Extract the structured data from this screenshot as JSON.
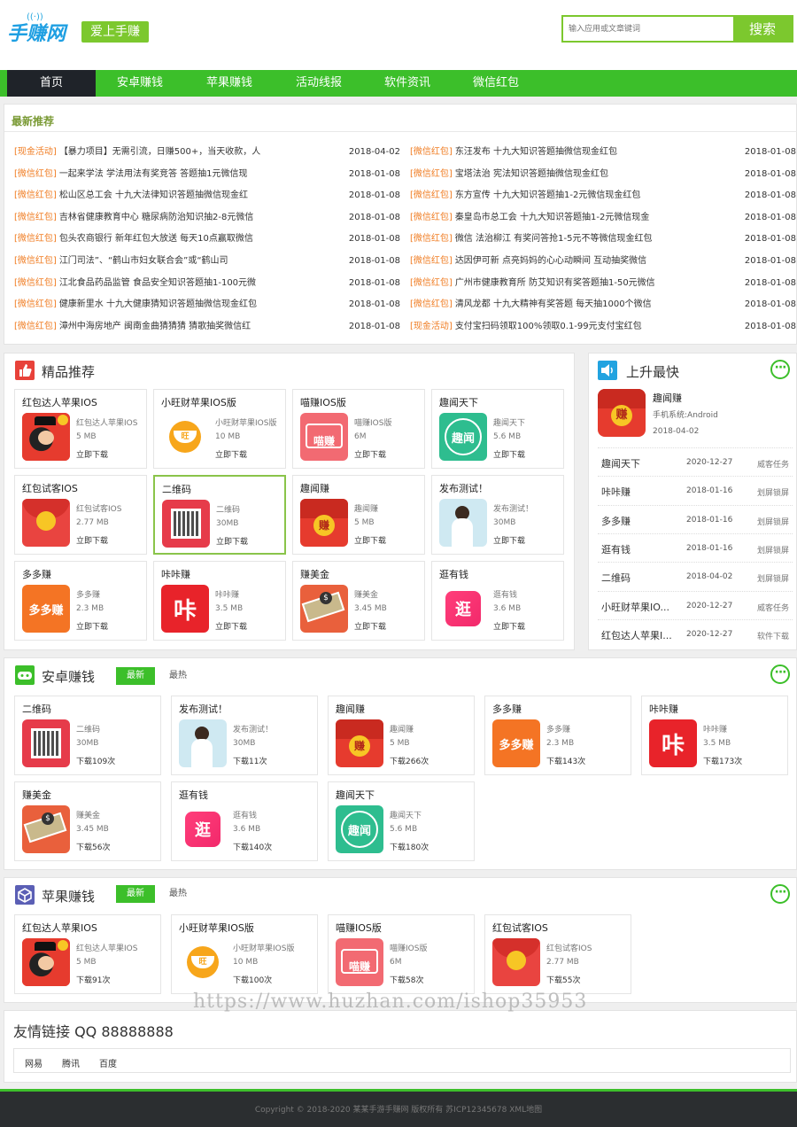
{
  "header": {
    "logo_text": "手赚网",
    "slogan": "爱上手赚",
    "search_placeholder": "输入应用或文章键词",
    "search_button": "搜索"
  },
  "nav": [
    "首页",
    "安卓赚钱",
    "苹果赚钱",
    "活动线报",
    "软件资讯",
    "微信红包"
  ],
  "latest": {
    "title": "最新推荐",
    "left": [
      {
        "cat": "[现金活动]",
        "title": "【暴力项目】无需引流，日赚500+，当天收款，人",
        "date": "2018-04-02"
      },
      {
        "cat": "[微信红包]",
        "title": "一起来学法 学法用法有奖竞答 答题抽1元微信现",
        "date": "2018-01-08"
      },
      {
        "cat": "[微信红包]",
        "title": "松山区总工会 十九大法律知识答题抽微信现金红",
        "date": "2018-01-08"
      },
      {
        "cat": "[微信红包]",
        "title": "吉林省健康教育中心 糖尿病防治知识抽2-8元微信",
        "date": "2018-01-08"
      },
      {
        "cat": "[微信红包]",
        "title": "包头农商银行 新年红包大放送 每天10点赢取微信",
        "date": "2018-01-08"
      },
      {
        "cat": "[微信红包]",
        "title": "江门司法”、“鹤山市妇女联合会”或“鹤山司",
        "date": "2018-01-08"
      },
      {
        "cat": "[微信红包]",
        "title": "江北食品药品监管 食品安全知识答题抽1-100元微",
        "date": "2018-01-08"
      },
      {
        "cat": "[微信红包]",
        "title": "健康新里水 十九大健康猜知识答题抽微信现金红包",
        "date": "2018-01-08"
      },
      {
        "cat": "[微信红包]",
        "title": "漳州中海房地产 闽南金曲猜猜猜 猜歌抽奖微信红",
        "date": "2018-01-08"
      }
    ],
    "right": [
      {
        "cat": "[微信红包]",
        "title": "东汪发布 十九大知识答题抽微信现金红包",
        "date": "2018-01-08"
      },
      {
        "cat": "[微信红包]",
        "title": "宝塔法治 宪法知识答题抽微信现金红包",
        "date": "2018-01-08"
      },
      {
        "cat": "[微信红包]",
        "title": "东方宣传 十九大知识答题抽1-2元微信现金红包",
        "date": "2018-01-08"
      },
      {
        "cat": "[微信红包]",
        "title": "秦皇岛市总工会 十九大知识答题抽1-2元微信现金",
        "date": "2018-01-08"
      },
      {
        "cat": "[微信红包]",
        "title": "微信 法治柳江 有奖问答抢1-5元不等微信现金红包",
        "date": "2018-01-08"
      },
      {
        "cat": "[微信红包]",
        "title": "达因伊可新 点亮妈妈的心心动瞬间 互动抽奖微信",
        "date": "2018-01-08"
      },
      {
        "cat": "[微信红包]",
        "title": "广州市健康教育所 防艾知识有奖答题抽1-50元微信",
        "date": "2018-01-08"
      },
      {
        "cat": "[微信红包]",
        "title": "清风龙都 十九大精神有奖答题 每天抽1000个微信",
        "date": "2018-01-08"
      },
      {
        "cat": "[现金活动]",
        "title": "支付宝扫码领取100%领取0.1-99元支付宝红包",
        "date": "2018-01-08"
      }
    ]
  },
  "featured": {
    "title": "精品推荐",
    "apps": [
      {
        "name": "红包达人苹果IOS",
        "sub": "红包达人苹果IOS",
        "size": "5 MB",
        "action": "立即下载",
        "icon": "hongbao-daren-icon"
      },
      {
        "name": "小旺财苹果IOS版",
        "sub": "小旺财苹果IOS版",
        "size": "10 MB",
        "action": "立即下载",
        "icon": "xiaowangcai-icon"
      },
      {
        "name": "喵赚IOS版",
        "sub": "喵赚IOS版",
        "size": "6M",
        "action": "立即下载",
        "icon": "miaozhuan-icon"
      },
      {
        "name": "趣闻天下",
        "sub": "趣闻天下",
        "size": "5.6 MB",
        "action": "立即下载",
        "icon": "quwen-icon"
      },
      {
        "name": "红包试客IOS",
        "sub": "红包试客IOS",
        "size": "2.77 MB",
        "action": "立即下载",
        "icon": "hongbao-shike-icon"
      },
      {
        "name": "二维码",
        "sub": "二维码",
        "size": "30MB",
        "action": "立即下载",
        "icon": "qrcode-icon"
      },
      {
        "name": "趣闻赚",
        "sub": "趣闻赚",
        "size": "5 MB",
        "action": "立即下载",
        "icon": "quwenzhuan-icon"
      },
      {
        "name": "发布测试！",
        "sub": "发布测试！",
        "size": "30MB",
        "action": "立即下载",
        "icon": "photo-icon"
      },
      {
        "name": "多多赚",
        "sub": "多多赚",
        "size": "2.3 MB",
        "action": "立即下载",
        "icon": "duoduozhuan-icon"
      },
      {
        "name": "咔咔赚",
        "sub": "咔咔赚",
        "size": "3.5 MB",
        "action": "立即下载",
        "icon": "kakazhuan-icon"
      },
      {
        "name": "赚美金",
        "sub": "赚美金",
        "size": "3.45 MB",
        "action": "立即下载",
        "icon": "zhuanmeijin-icon"
      },
      {
        "name": "逛有钱",
        "sub": "逛有钱",
        "size": "3.6 MB",
        "action": "立即下载",
        "icon": "guangyouqian-icon"
      }
    ]
  },
  "rising": {
    "title": "上升最快",
    "top": {
      "name": "趣闻赚",
      "system": "手机系统:Android",
      "date": "2018-04-02"
    },
    "items": [
      {
        "name": "趣闻天下",
        "date": "2020-12-27",
        "cat": "威客任务"
      },
      {
        "name": "咔咔赚",
        "date": "2018-01-16",
        "cat": "划屏锁屏"
      },
      {
        "name": "多多赚",
        "date": "2018-01-16",
        "cat": "划屏锁屏"
      },
      {
        "name": "逛有钱",
        "date": "2018-01-16",
        "cat": "划屏锁屏"
      },
      {
        "name": "二维码",
        "date": "2018-04-02",
        "cat": "划屏锁屏"
      },
      {
        "name": "小旺财苹果IO...",
        "date": "2020-12-27",
        "cat": "威客任务"
      },
      {
        "name": "红包达人苹果I...",
        "date": "2020-12-27",
        "cat": "软件下载"
      }
    ]
  },
  "android": {
    "title": "安卓赚钱",
    "tab_new": "最新",
    "tab_hot": "最热",
    "apps": [
      {
        "name": "二维码",
        "sub": "二维码",
        "size": "30MB",
        "dl": "下载109次",
        "icon": "qrcode-icon"
      },
      {
        "name": "发布测试！",
        "sub": "发布测试！",
        "size": "30MB",
        "dl": "下载11次",
        "icon": "photo-icon"
      },
      {
        "name": "趣闻赚",
        "sub": "趣闻赚",
        "size": "5 MB",
        "dl": "下载266次",
        "icon": "quwenzhuan-icon"
      },
      {
        "name": "多多赚",
        "sub": "多多赚",
        "size": "2.3 MB",
        "dl": "下载143次",
        "icon": "duoduozhuan-icon"
      },
      {
        "name": "咔咔赚",
        "sub": "咔咔赚",
        "size": "3.5 MB",
        "dl": "下载173次",
        "icon": "kakazhuan-icon"
      },
      {
        "name": "赚美金",
        "sub": "赚美金",
        "size": "3.45 MB",
        "dl": "下载56次",
        "icon": "zhuanmeijin-icon"
      },
      {
        "name": "逛有钱",
        "sub": "逛有钱",
        "size": "3.6 MB",
        "dl": "下载140次",
        "icon": "guangyouqian-icon"
      },
      {
        "name": "趣闻天下",
        "sub": "趣闻天下",
        "size": "5.6 MB",
        "dl": "下载180次",
        "icon": "quwen-icon"
      }
    ]
  },
  "apple": {
    "title": "苹果赚钱",
    "tab_new": "最新",
    "tab_hot": "最热",
    "apps": [
      {
        "name": "红包达人苹果IOS",
        "sub": "红包达人苹果IOS",
        "size": "5 MB",
        "dl": "下载91次",
        "icon": "hongbao-daren-icon"
      },
      {
        "name": "小旺财苹果IOS版",
        "sub": "小旺财苹果IOS版",
        "size": "10 MB",
        "dl": "下载100次",
        "icon": "xiaowangcai-icon"
      },
      {
        "name": "喵赚IOS版",
        "sub": "喵赚IOS版",
        "size": "6M",
        "dl": "下载58次",
        "icon": "miaozhuan-icon"
      },
      {
        "name": "红包试客IOS",
        "sub": "红包试客IOS",
        "size": "2.77 MB",
        "dl": "下载55次",
        "icon": "hongbao-shike-icon"
      }
    ]
  },
  "links": {
    "title": "友情链接 QQ 88888888",
    "items": [
      "网易",
      "腾讯",
      "百度"
    ]
  },
  "watermark": "https://www.huzhan.com/ishop35953",
  "footer": "Copyright © 2018-2020 某某手游手赚网 版权所有 苏ICP12345678 XML地图",
  "colors": {
    "accent": "#3cbf2a",
    "nav_active": "#1f2329",
    "category": "#f07c22"
  }
}
